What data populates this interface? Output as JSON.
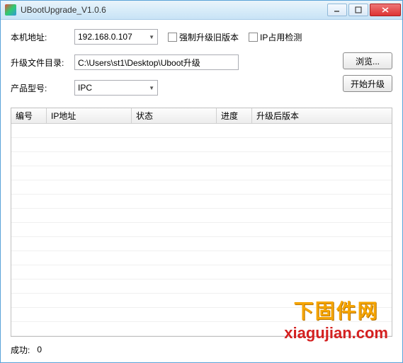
{
  "window": {
    "title": "UBootUpgrade_V1.0.6"
  },
  "form": {
    "local_ip_label": "本机地址:",
    "local_ip_value": "192.168.0.107",
    "force_old_label": "强制升级旧版本",
    "ip_check_label": "IP占用检测",
    "dir_label": "升级文件目录:",
    "dir_value": "C:\\Users\\st1\\Desktop\\Uboot升级",
    "model_label": "产品型号:",
    "model_value": "IPC"
  },
  "buttons": {
    "browse": "浏览...",
    "start": "开始升级"
  },
  "table": {
    "columns": [
      "编号",
      "IP地址",
      "状态",
      "进度",
      "升级后版本"
    ]
  },
  "status": {
    "success_label": "成功:",
    "success_count": "0"
  },
  "watermark": {
    "line1": "下固件网",
    "line2": "xiagujian.com"
  }
}
